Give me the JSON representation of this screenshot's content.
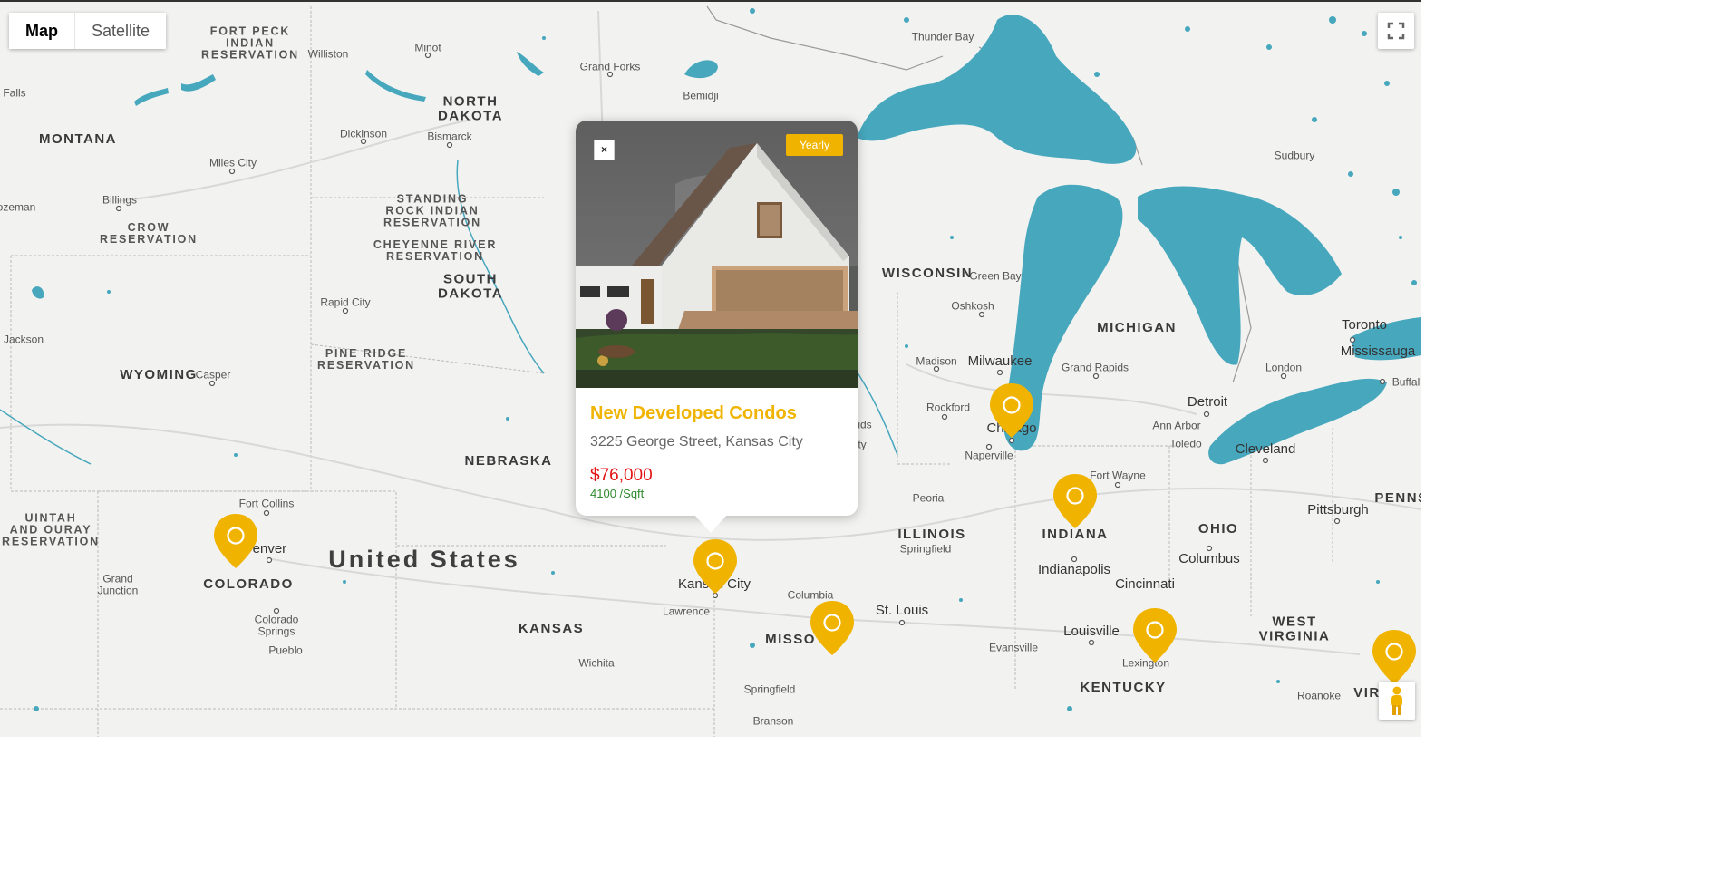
{
  "map_type": {
    "map_label": "Map",
    "satellite_label": "Satellite",
    "selected": "Map"
  },
  "controls": {
    "fullscreen_icon": "fullscreen-icon",
    "pegman_icon": "street-view-pegman-icon"
  },
  "colors": {
    "water": "#46a7bd",
    "land": "#f2f2f1",
    "pin": "#f0b400",
    "accent": "#f0b400",
    "price": "#e41212",
    "area": "#2e8b2e"
  },
  "labels": {
    "country": "United States",
    "states": {
      "montana": "MONTANA",
      "north_dakota": "NORTH\nDAKOTA",
      "south_dakota": "SOUTH\nDAKOTA",
      "wyoming": "WYOMING",
      "nebraska": "NEBRASKA",
      "colorado": "COLORADO",
      "kansas": "KANSAS",
      "missouri": "MISSO",
      "wisconsin": "WISCONSIN",
      "michigan": "MICHIGAN",
      "illinois": "ILLINOIS",
      "indiana": "INDIANA",
      "ohio": "OHIO",
      "kentucky": "KENTUCKY",
      "west_virginia": "WEST\nVIRGINIA",
      "virginia": "VIR",
      "penn": "PENNS"
    },
    "reservations": {
      "fort_peck": "FORT PECK\nINDIAN\nRESERVATION",
      "crow": "CROW\nRESERVATION",
      "standing_rock": "STANDING\nROCK INDIAN\nRESERVATION",
      "cheyenne_river": "CHEYENNE RIVER\nRESERVATION",
      "pine_ridge": "PINE RIDGE\nRESERVATION",
      "uintah": "UINTAH\nAND OURAY\nRESERVATION"
    },
    "cities": {
      "falls": "Falls",
      "williston": "Williston",
      "minot": "Minot",
      "grand_forks": "Grand Forks",
      "bemidji": "Bemidji",
      "thunder_bay": "Thunder Bay",
      "dickinson": "Dickinson",
      "bismarck": "Bismarck",
      "miles_city": "Miles City",
      "billings": "Billings",
      "bozeman": "ozeman",
      "sudbury": "Sudbury",
      "rapid_city": "Rapid City",
      "green_bay": "Green Bay",
      "oshkosh": "Oshkosh",
      "toronto": "Toronto",
      "mississauga": "Mississauga",
      "jackson": "Jackson",
      "casper": "Casper",
      "madison": "Madison",
      "milwaukee": "Milwaukee",
      "grand_rapids": "Grand Rapids",
      "london": "London",
      "buffalo": "Buffal",
      "rockford": "Rockford",
      "detroit": "Detroit",
      "ann_arbor": "Ann Arbor",
      "chicago": "Chicago",
      "ids": "ids",
      "ty": "ty",
      "naperville": "Naperville",
      "toledo": "Toledo",
      "cleveland": "Cleveland",
      "fort_wayne": "Fort Wayne",
      "fort_collins": "Fort Collins",
      "peoria": "Peoria",
      "pittsburgh": "Pittsburgh",
      "denver": "Denver",
      "springfield_il": "Springfield",
      "indianapolis": "Indianapolis",
      "columbus": "Columbus",
      "kansas_city": "Kansas City",
      "grand_junction": "Grand\nJunction",
      "cincinnati": "Cincinnati",
      "columbia": "Columbia",
      "lawrence": "Lawrence",
      "st_louis": "St. Louis",
      "colorado_springs": "Colorado\nSprings",
      "louisville": "Louisville",
      "pueblo": "Pueblo",
      "evansville": "Evansville",
      "lexington": "Lexington",
      "wichita": "Wichita",
      "springfield_mo": "Springfield",
      "roanoke": "Roanoke",
      "branson": "Branson"
    }
  },
  "popup": {
    "badge": "Yearly",
    "close_label": "×",
    "title": "New Developed Condos",
    "address": "3225 George Street, Kansas City",
    "price": "$76,000",
    "area": "4100 /Sqft"
  },
  "markers": [
    {
      "name": "colorado-marker"
    },
    {
      "name": "kansas-city-marker"
    },
    {
      "name": "missouri-marker"
    },
    {
      "name": "chicago-marker"
    },
    {
      "name": "indiana-marker"
    },
    {
      "name": "kentucky-marker"
    },
    {
      "name": "virginia-marker"
    }
  ]
}
